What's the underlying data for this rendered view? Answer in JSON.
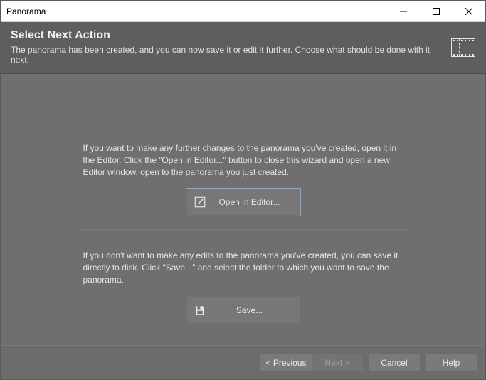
{
  "window": {
    "title": "Panorama"
  },
  "header": {
    "title": "Select Next Action",
    "subtitle": "The panorama has been created, and you can now save it or edit it further. Choose what should be done with it next."
  },
  "content": {
    "editor_text": "If you want to make any further changes to the panorama you've created, open it in the Editor. Click the \"Open in Editor...\" button to close this wizard and open a new Editor window, open to the panorama you just created.",
    "editor_button": "Open in Editor...",
    "save_text": "If you don't want to make any edits to the panorama you've created, you can save it directly to disk. Click \"Save...\" and select the folder to which you want to save the panorama.",
    "save_button": "Save..."
  },
  "footer": {
    "previous": "< Previous",
    "next": "Next >",
    "cancel": "Cancel",
    "help": "Help"
  }
}
